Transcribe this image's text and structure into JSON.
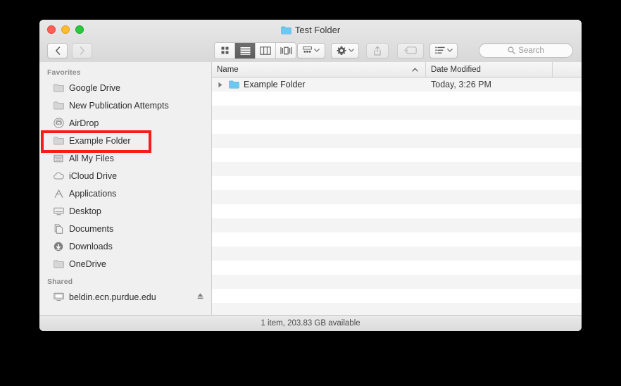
{
  "window": {
    "title": "Test Folder",
    "title_icon": "folder-icon"
  },
  "traffic_lights": {
    "close": "close-button",
    "minimize": "minimize-button",
    "zoom": "zoom-button",
    "close_color": "#ff5f56",
    "minimize_color": "#ffbd2e",
    "zoom_color": "#27c93f"
  },
  "toolbar": {
    "back_label": "‹",
    "forward_label": "›",
    "view_modes": [
      {
        "name": "icon-view",
        "active": false
      },
      {
        "name": "list-view",
        "active": true
      },
      {
        "name": "column-view",
        "active": false
      },
      {
        "name": "coverflow-view",
        "active": false
      }
    ],
    "arrange_label": "arrange-icon",
    "action_label": "gear-icon",
    "share_label": "share-icon",
    "tag_label": "tag-icon",
    "list_options_label": "list-options-icon",
    "chevron": "⌄"
  },
  "search": {
    "placeholder": "Search",
    "icon": "search-icon"
  },
  "sidebar": {
    "sections": [
      {
        "header": "Favorites",
        "items": [
          {
            "label": "Google Drive",
            "icon": "folder-icon"
          },
          {
            "label": "New Publication Attempts",
            "icon": "folder-icon"
          },
          {
            "label": "AirDrop",
            "icon": "airdrop-icon"
          },
          {
            "label": "Example Folder",
            "icon": "folder-icon",
            "highlighted": true
          },
          {
            "label": "All My Files",
            "icon": "all-my-files-icon"
          },
          {
            "label": "iCloud Drive",
            "icon": "cloud-icon"
          },
          {
            "label": "Applications",
            "icon": "applications-icon"
          },
          {
            "label": "Desktop",
            "icon": "desktop-icon"
          },
          {
            "label": "Documents",
            "icon": "documents-icon"
          },
          {
            "label": "Downloads",
            "icon": "downloads-icon"
          },
          {
            "label": "OneDrive",
            "icon": "folder-icon"
          }
        ]
      },
      {
        "header": "Shared",
        "items": [
          {
            "label": "beldin.ecn.purdue.edu",
            "icon": "server-icon",
            "eject": true
          }
        ]
      }
    ]
  },
  "filelist": {
    "columns": [
      {
        "label": "Name",
        "sorted": "asc"
      },
      {
        "label": "Date Modified",
        "sorted": ""
      },
      {
        "label": "",
        "sorted": ""
      }
    ],
    "rows": [
      {
        "name": "Example Folder",
        "date_modified": "Today, 3:26 PM",
        "icon": "folder-icon",
        "expandable": true
      }
    ],
    "empty_row_count": 16
  },
  "statusbar": {
    "text": "1 item, 203.83 GB available"
  },
  "annotation": {
    "type": "highlight-rectangle",
    "color": "#f91b1b",
    "target": "Example Folder"
  }
}
